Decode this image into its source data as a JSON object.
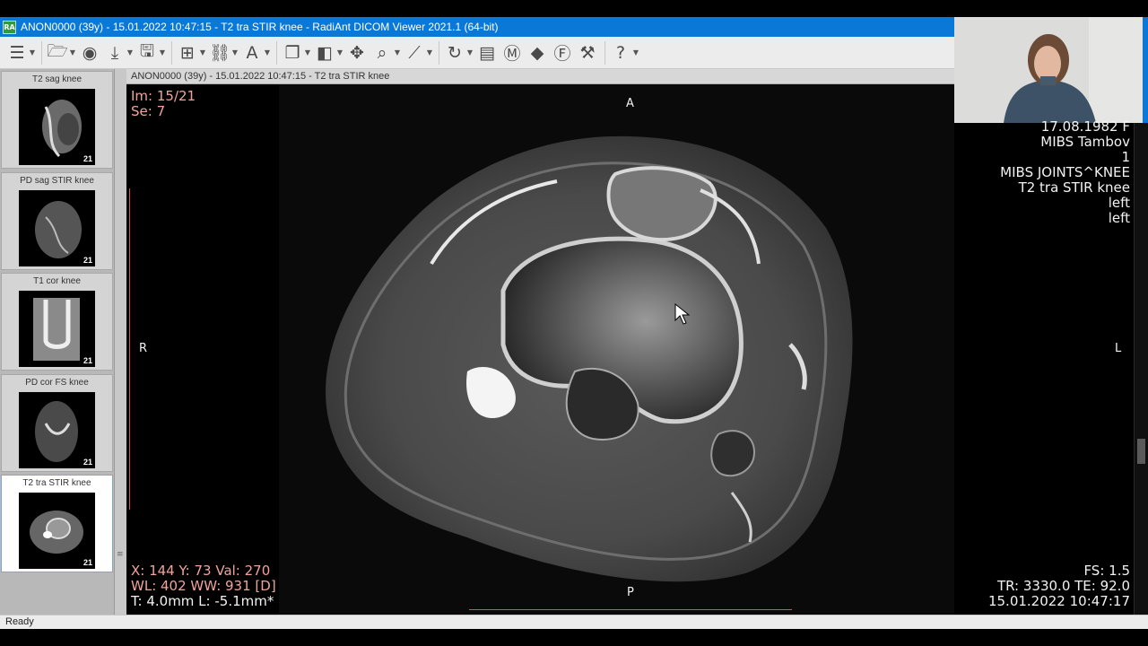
{
  "window": {
    "title": "ANON0000 (39y) - 15.01.2022 10:47:15 - T2 tra STIR knee - RadiAnt DICOM Viewer 2021.1 (64-bit)",
    "icon_text": "RA"
  },
  "toolbar": {
    "groups": [
      {
        "items": [
          {
            "icon": "layout-menu-icon",
            "glyph": "☰",
            "dropdown": true
          }
        ]
      },
      {
        "items": [
          {
            "icon": "open-folder-icon",
            "glyph": "🗁",
            "dropdown": true
          },
          {
            "icon": "dvd-icon",
            "glyph": "◉",
            "dropdown": false
          },
          {
            "icon": "download-icon",
            "glyph": "⤓",
            "dropdown": true
          },
          {
            "icon": "save-icon",
            "glyph": "🖫",
            "dropdown": true
          }
        ]
      },
      {
        "items": [
          {
            "icon": "layout-grid-icon",
            "glyph": "⊞",
            "dropdown": true
          },
          {
            "icon": "link-icon",
            "glyph": "⛓",
            "dropdown": true
          },
          {
            "icon": "annotation-text-icon",
            "glyph": "A",
            "dropdown": true
          }
        ]
      },
      {
        "items": [
          {
            "icon": "series-stack-icon",
            "glyph": "❐",
            "dropdown": true
          },
          {
            "icon": "window-level-icon",
            "glyph": "◧",
            "dropdown": true
          },
          {
            "icon": "pan-icon",
            "glyph": "✥",
            "dropdown": false
          },
          {
            "icon": "zoom-icon",
            "glyph": "⌕",
            "dropdown": true
          },
          {
            "icon": "measure-icon",
            "glyph": "⟋",
            "dropdown": true
          }
        ]
      },
      {
        "items": [
          {
            "icon": "rotate-icon",
            "glyph": "↻",
            "dropdown": true
          },
          {
            "icon": "film-icon",
            "glyph": "▤",
            "dropdown": false
          },
          {
            "icon": "mpr-icon",
            "glyph": "Ⓜ",
            "dropdown": false
          },
          {
            "icon": "3d-icon",
            "glyph": "◆",
            "dropdown": false
          },
          {
            "icon": "fusion-icon",
            "glyph": "Ⓕ",
            "dropdown": false
          },
          {
            "icon": "tools-icon",
            "glyph": "⚒",
            "dropdown": false
          }
        ]
      },
      {
        "items": [
          {
            "icon": "help-icon",
            "glyph": "?",
            "dropdown": true
          }
        ]
      }
    ]
  },
  "series": [
    {
      "label": "T2 sag knee",
      "count": "21",
      "active": false
    },
    {
      "label": "PD sag STIR knee",
      "count": "21",
      "active": false
    },
    {
      "label": "T1 cor knee",
      "count": "21",
      "active": false
    },
    {
      "label": "PD cor FS knee",
      "count": "21",
      "active": false
    },
    {
      "label": "T2 tra STIR knee",
      "count": "21",
      "active": true
    }
  ],
  "viewer": {
    "header": "ANON0000  (39y) - 15.01.2022 10:47:15 - T2 tra STIR knee",
    "top_left": [
      "Im: 15/21",
      "Se: 7"
    ],
    "top_right": [
      "17.08.1982 F",
      "MIBS Tambov",
      "1",
      "MIBS JOINTS^KNEE",
      "T2 tra STIR knee",
      "left",
      "left"
    ],
    "bottom_left": [
      "X: 144 Y: 73 Val: 270",
      "WL: 402 WW: 931 [D]",
      "T: 4.0mm L: -5.1mm*"
    ],
    "bottom_right": [
      "FS: 1.5",
      "TR: 3330.0 TE: 92.0",
      "15.01.2022 10:47:17"
    ],
    "orientation": {
      "top": "A",
      "bottom": "P",
      "left": "R",
      "right": "L"
    }
  },
  "status": {
    "text": "Ready"
  },
  "colors": {
    "titlebar": "#0a78d7",
    "overlay_pink": "#f1a39a",
    "overlay_white": "#f2f2f2"
  }
}
